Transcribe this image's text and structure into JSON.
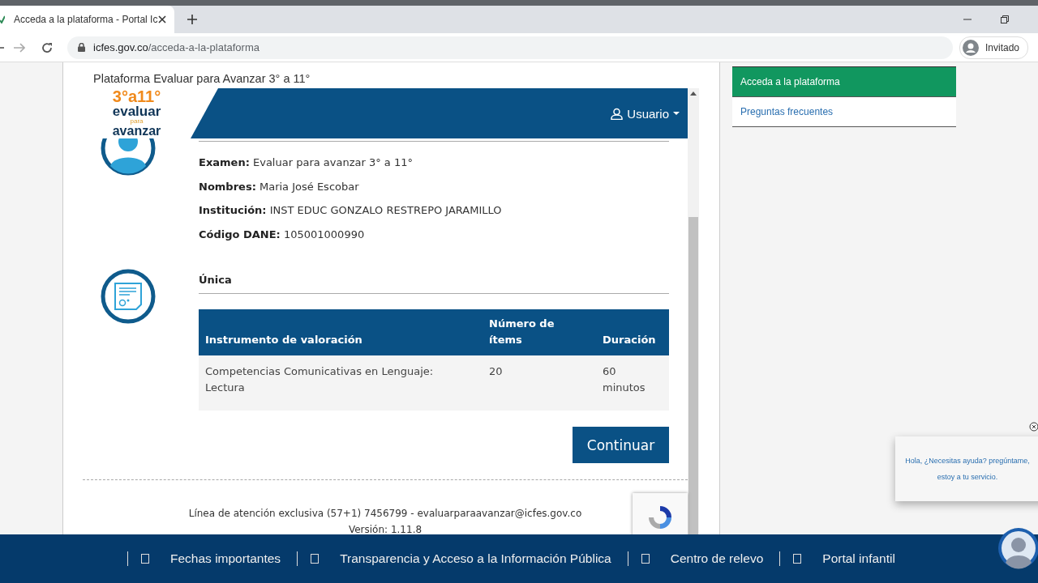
{
  "browser": {
    "tab_title": "Acceda a la plataforma - Portal Ic",
    "url_domain": "icfes.gov.co",
    "url_path": "/acceda-a-la-plataforma",
    "profile": "Invitado"
  },
  "page_title": "Plataforma Evaluar para Avanzar 3° a 11°",
  "logo": {
    "line_1": "3°a11°",
    "line_2": "evaluar",
    "line_3": "para",
    "line_4": "avanzar"
  },
  "header": {
    "user_menu": "Usuario"
  },
  "exam_fields": [
    {
      "label": "Examen:",
      "value": "Evaluar para avanzar 3° a 11°"
    },
    {
      "label": "Nombres:",
      "value": "Maria José Escobar"
    },
    {
      "label": "Institución:",
      "value": "INST EDUC GONZALO RESTREPO JARAMILLO"
    },
    {
      "label": "Código DANE:",
      "value": "105001000990"
    }
  ],
  "section_title": "Única",
  "table": {
    "columns": [
      "Instrumento de valoración",
      "Número de ítems",
      "Duración"
    ],
    "rows": [
      [
        "Competencias Comunicativas en Lenguaje: Lectura",
        "20",
        "60 minutos"
      ]
    ]
  },
  "continue_button": "Continuar",
  "footer_contact": "Línea de atención exclusiva (57+1) 7456799 - evaluarparaavanzar@icfes.gov.co",
  "version": "Versión: 1.11.8",
  "sidebar": {
    "items": [
      {
        "label": "Acceda a la plataforma",
        "selected": true
      },
      {
        "label": "Preguntas frecuentes",
        "selected": false
      }
    ]
  },
  "chat": {
    "message": "Hola, ¿Necesitas ayuda? pregúntame, estoy a tu servicio."
  },
  "footer_links": [
    "Fechas importantes",
    "Transparencia y Acceso a la Información Pública",
    "Centro de relevo",
    "Portal infantil"
  ]
}
